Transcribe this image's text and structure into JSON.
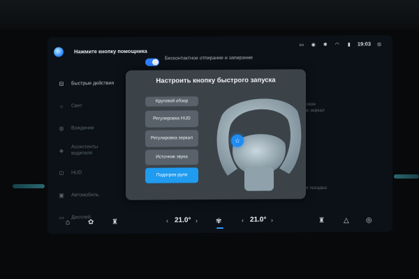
{
  "status_bar": {
    "assistant_label": "Нажмите кнопку помощника",
    "keyless_label": "Бесконтактное отпирание и запирание",
    "icons": [
      "message-icon",
      "audio-icon",
      "bluetooth-icon",
      "wifi-icon",
      "signal-icon"
    ],
    "time": "19:03",
    "profile_icon": "profile-icon"
  },
  "sidebar": {
    "items": [
      {
        "label": "Быстрые действия",
        "icon": "quick-actions-icon",
        "active": true
      },
      {
        "label": "Свет",
        "icon": "light-icon"
      },
      {
        "label": "Вождение",
        "icon": "driving-icon"
      },
      {
        "label": "Ассистенты водителя",
        "icon": "assist-icon"
      },
      {
        "label": "HUD",
        "icon": "hud-icon"
      },
      {
        "label": "Автомобиль",
        "icon": "car-icon"
      },
      {
        "label": "Дисплей",
        "icon": "display-icon"
      }
    ]
  },
  "background_right": {
    "line1": "ическое",
    "line2": "ание зеркал",
    "line3": "тная посадка"
  },
  "modal": {
    "title": "Настроить кнопку быстрого запуска",
    "options": [
      {
        "label": "Круговой обзор"
      },
      {
        "label": "Регулировка HUD"
      },
      {
        "label": "Регулировка зеркал"
      },
      {
        "label": "Источник звука"
      },
      {
        "label": "Подогрев руля",
        "selected": true
      }
    ],
    "wheel_button_icon": "star-icon"
  },
  "dock": {
    "left_temp": "21.0°",
    "right_temp": "21.0°",
    "chevron_left": "‹",
    "chevron_right": "›",
    "icons": [
      "home-icon",
      "apps-icon",
      "seat-left-icon",
      "fan-icon",
      "seat-right-icon",
      "navigation-icon",
      "steering-icon"
    ]
  },
  "colors": {
    "accent": "#1f9bf0",
    "modal_bg": "#3b4248",
    "option_bg": "#59626a"
  }
}
